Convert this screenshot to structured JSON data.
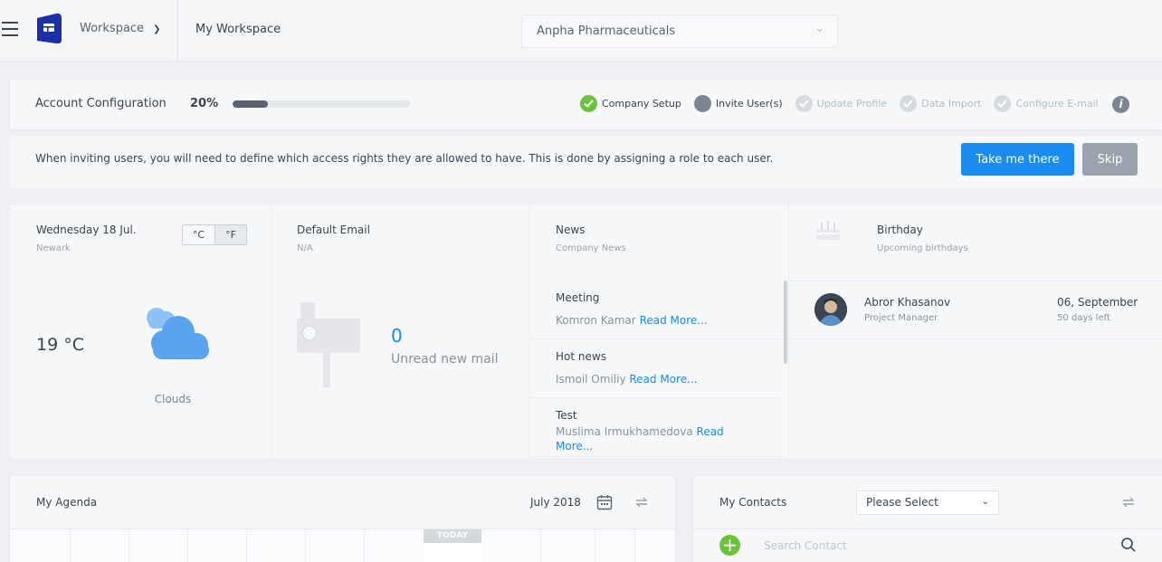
{
  "header": {
    "workspace_label": "Workspace",
    "workspace_title": "My Workspace",
    "company": "Anpha Pharmaceuticals"
  },
  "account_config": {
    "title": "Account Configuration",
    "percent_label": "20%",
    "progress": 0.2,
    "steps": [
      {
        "label": "Company Setup",
        "state": "done"
      },
      {
        "label": "Invite User(s)",
        "state": "current"
      },
      {
        "label": "Update Profile",
        "state": "todo"
      },
      {
        "label": "Data Import",
        "state": "todo"
      },
      {
        "label": "Configure E-mail",
        "state": "todo"
      }
    ],
    "info_icon": "i",
    "invite_text": "When inviting users, you will need to define which access rights they are allowed to have. This is done by assigning a role to each user.",
    "primary_button": "Take me there",
    "skip_button": "Skip"
  },
  "weather": {
    "date": "Wednesday 18 Jul.",
    "location": "Newark",
    "unit_c": "°C",
    "unit_f": "°F",
    "active_unit": "F",
    "temperature": "19 °C",
    "description": "Clouds",
    "icon": "cloud-icon"
  },
  "email": {
    "title": "Default Email",
    "address": "N/A",
    "count": "0",
    "label": "Unread new mail",
    "icon": "mailbox-icon"
  },
  "news": {
    "title": "News",
    "subtitle": "Company News",
    "read_more": "Read More...",
    "items": [
      {
        "title": "Meeting",
        "author": "Komron Kamar"
      },
      {
        "title": "Hot news",
        "author": "Ismoil Omiliy"
      },
      {
        "title": "Test",
        "author": "Muslima Irmukhamedova",
        "read_more_part1": "Read",
        "read_more_part2": "More..."
      }
    ]
  },
  "birthday": {
    "title": "Birthday",
    "subtitle": "Upcoming birthdays",
    "icon": "cake-icon",
    "people": [
      {
        "name": "Abror Khasanov",
        "role": "Project Manager",
        "date": "06, September",
        "days_left": "50 days left"
      }
    ]
  },
  "agenda": {
    "title": "My Agenda",
    "month": "July 2018",
    "today_label": "TODAY"
  },
  "contacts": {
    "title": "My Contacts",
    "select_value": "Please Select",
    "search_placeholder": "Search Contact"
  },
  "colors": {
    "accent": "#1a8cf0",
    "success": "#6dc23b",
    "muted": "#9aa3ad"
  }
}
